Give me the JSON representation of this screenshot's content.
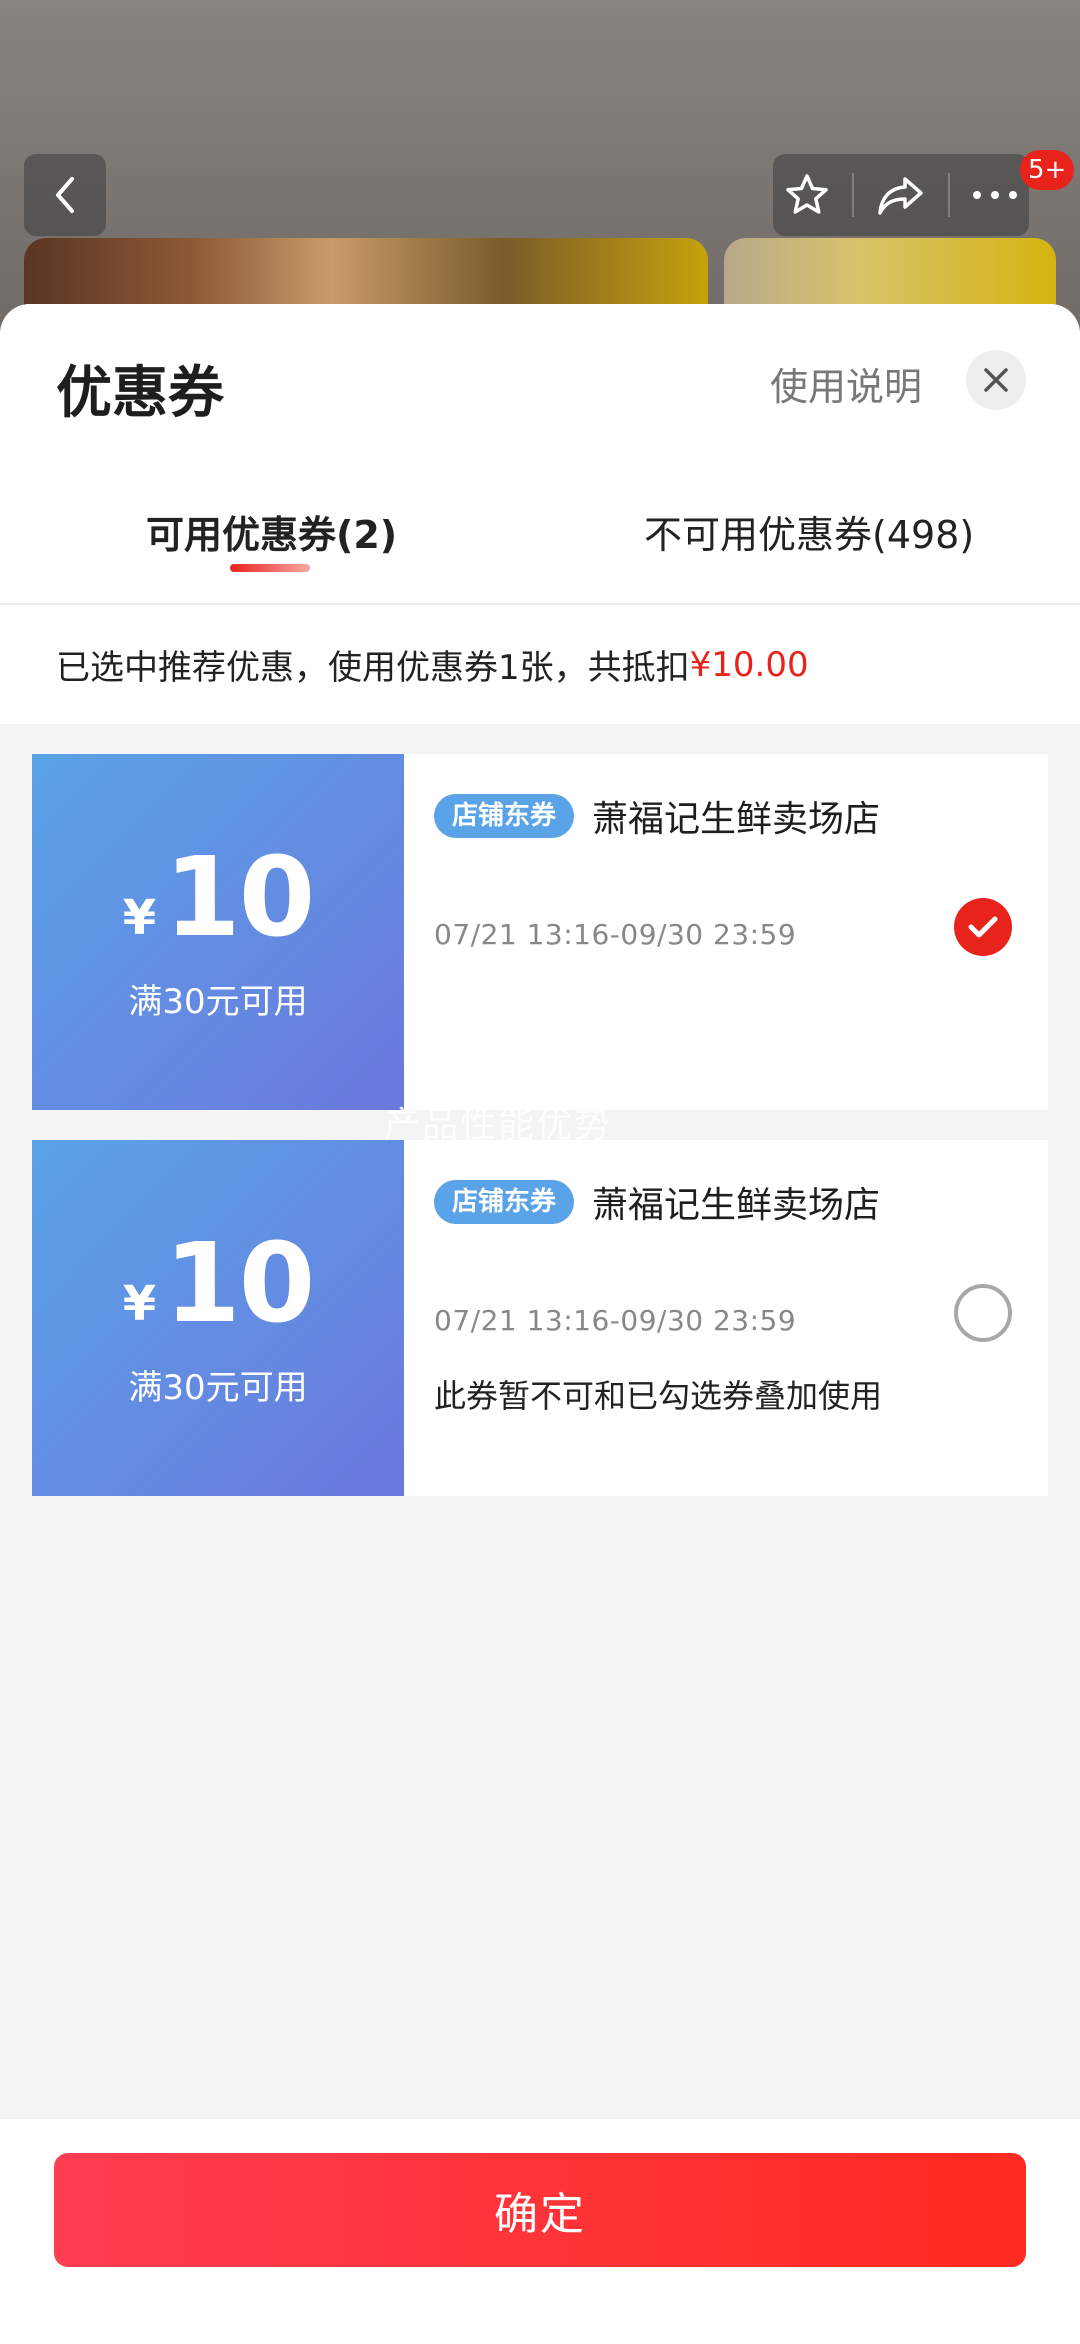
{
  "colors": {
    "accent_red": "#e8231c",
    "coupon_blue": "#5aa3e8",
    "coupon_purple": "#6b78dc",
    "confirm_gradient_start": "#ff3d52",
    "confirm_gradient_end": "#ff2a1f"
  },
  "top_bar": {
    "back_icon": "chevron-left-icon",
    "favorite_icon": "star-icon",
    "share_icon": "share-icon",
    "more_icon": "more-dots-icon",
    "message_badge": "5+"
  },
  "sheet": {
    "title": "优惠券",
    "help_label": "使用说明",
    "close_icon": "close-icon",
    "tabs": [
      {
        "label": "可用优惠券(2)",
        "active": true
      },
      {
        "label": "不可用优惠券(498)",
        "active": false
      }
    ],
    "summary": {
      "text": "已选中推荐优惠，使用优惠券1张，共抵扣",
      "amount": "¥10.00"
    }
  },
  "coupons": [
    {
      "currency": "¥",
      "value": "10",
      "threshold": "满30元可用",
      "tag": "店铺东券",
      "shop": "萧福记生鲜卖场店",
      "validity": "07/21 13:16-09/30 23:59",
      "note": "",
      "selected": true
    },
    {
      "currency": "¥",
      "value": "10",
      "threshold": "满30元可用",
      "tag": "店铺东券",
      "shop": "萧福记生鲜卖场店",
      "validity": "07/21 13:16-09/30 23:59",
      "note": "此券暂不可和已勾选券叠加使用",
      "selected": false
    }
  ],
  "watermark": "产品性能优势",
  "footer": {
    "confirm_label": "确定"
  }
}
